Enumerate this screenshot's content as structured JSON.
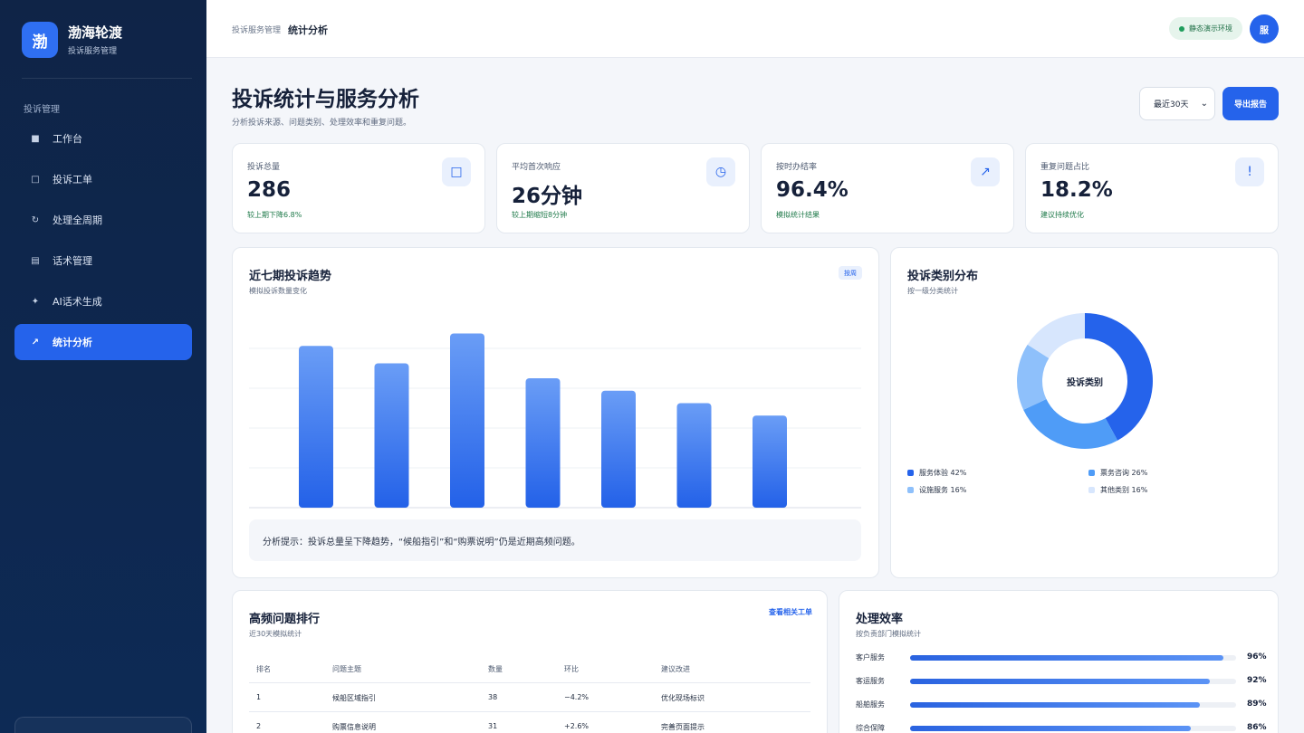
{
  "brand": {
    "logo": "渤",
    "name": "渤海轮渡",
    "subtitle": "投诉服务管理"
  },
  "sidebar": {
    "section": "投诉管理",
    "items": [
      {
        "label": "工作台",
        "icon": "■"
      },
      {
        "label": "投诉工单",
        "icon": "□"
      },
      {
        "label": "处理全周期",
        "icon": "↻"
      },
      {
        "label": "话术管理",
        "icon": "▤"
      },
      {
        "label": "AI话术生成",
        "icon": "✦"
      },
      {
        "label": "统计分析",
        "icon": "↗"
      }
    ]
  },
  "header": {
    "breadcrumb_parent": "投诉服务管理",
    "breadcrumb_current": "统计分析",
    "env_badge": "静态演示环境",
    "avatar": "服"
  },
  "page": {
    "title": "投诉统计与服务分析",
    "subtitle": "分析投诉来源、问题类别、处理效率和重复问题。",
    "range_select": "最近30天",
    "export_label": "导出报告"
  },
  "kpis": [
    {
      "label": "投诉总量",
      "value": "286",
      "note": "较上期下降6.8%",
      "icon": "□"
    },
    {
      "label": "平均首次响应",
      "value": "26分钟",
      "note": "较上期缩短8分钟",
      "icon": "◷"
    },
    {
      "label": "按时办结率",
      "value": "96.4%",
      "note": "模拟统计结果",
      "icon": "↗"
    },
    {
      "label": "重复问题占比",
      "value": "18.2%",
      "note": "建议持续优化",
      "icon": "!"
    }
  ],
  "trend_card": {
    "title": "近七期投诉趋势",
    "subtitle": "模拟投诉数量变化",
    "chip": "按周",
    "hint": "分析提示：投诉总量呈下降趋势，“候船指引”和“购票说明”仍是近期高频问题。"
  },
  "chart_data": [
    {
      "type": "bar",
      "values": [
        65,
        58,
        70,
        52,
        47,
        42,
        37
      ],
      "ylim": [
        0,
        80
      ],
      "grid": true,
      "color": "#3b7cf0"
    },
    {
      "type": "pie",
      "title": "投诉类别",
      "categories": [
        "服务体验",
        "票务咨询",
        "设施服务",
        "其他类别"
      ],
      "values": [
        42,
        26,
        16,
        16
      ],
      "colors": [
        "#2563eb",
        "#4f9cf7",
        "#8ec0fb",
        "#d7e6fd"
      ],
      "legend": "bottom"
    }
  ],
  "category_card": {
    "title": "投诉类别分布",
    "subtitle": "按一级分类统计",
    "center_label": "投诉类别",
    "legend": [
      {
        "text": "服务体验 42%",
        "color": "#2563eb"
      },
      {
        "text": "票务咨询 26%",
        "color": "#4f9cf7"
      },
      {
        "text": "设施服务 16%",
        "color": "#8ec0fb"
      },
      {
        "text": "其他类别 16%",
        "color": "#d7e6fd"
      }
    ]
  },
  "ranking": {
    "title": "高频问题排行",
    "subtitle": "近30天模拟统计",
    "action": "查看相关工单",
    "columns": [
      "排名",
      "问题主题",
      "数量",
      "环比",
      "建议改进"
    ],
    "rows": [
      [
        "1",
        "候船区域指引",
        "38",
        "−4.2%",
        "优化现场标识"
      ],
      [
        "2",
        "购票信息说明",
        "31",
        "+2.6%",
        "完善页面提示"
      ]
    ]
  },
  "efficiency": {
    "title": "处理效率",
    "subtitle": "按负责部门模拟统计",
    "rows": [
      {
        "label": "客户服务",
        "pct": "96%",
        "value": 96
      },
      {
        "label": "客运服务",
        "pct": "92%",
        "value": 92
      },
      {
        "label": "船舶服务",
        "pct": "89%",
        "value": 89
      },
      {
        "label": "综合保障",
        "pct": "86%",
        "value": 86
      }
    ]
  }
}
